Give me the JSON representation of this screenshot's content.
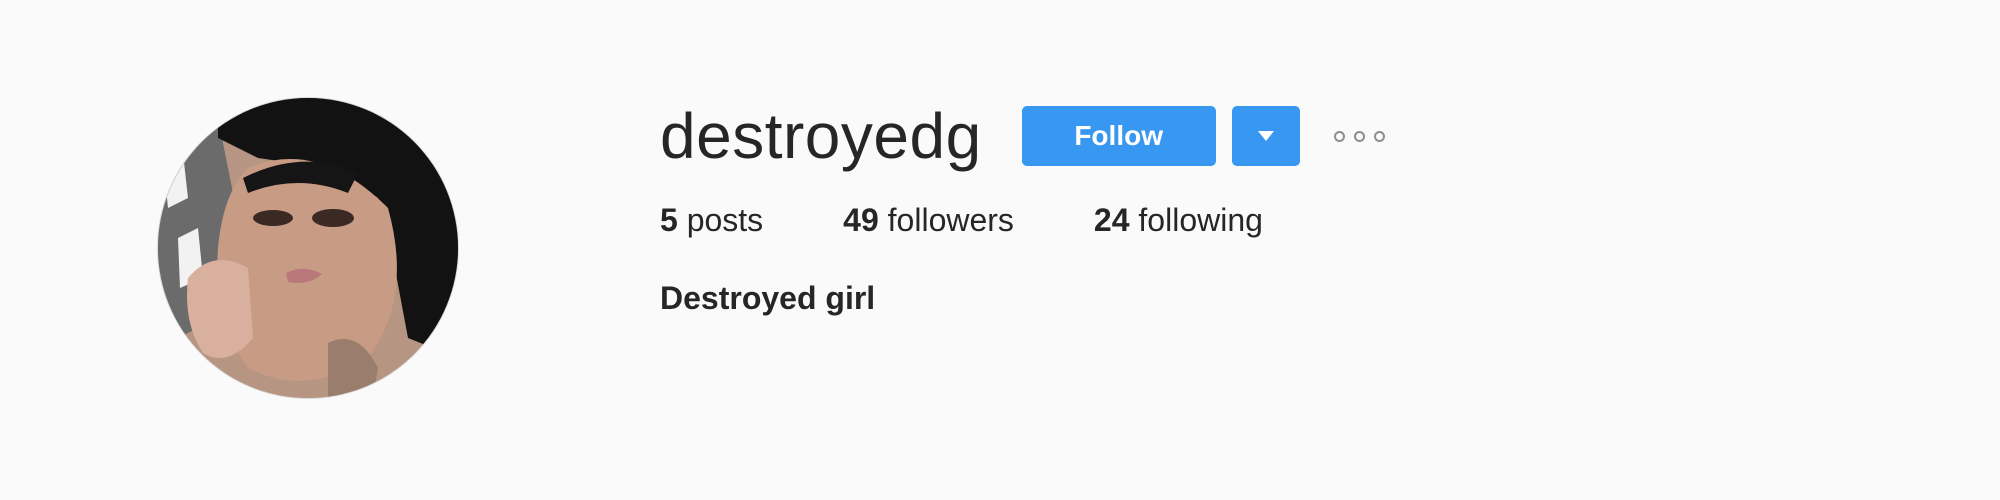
{
  "profile": {
    "username": "destroyedg",
    "full_name": "Destroyed girl",
    "avatar_alt": "destroyedg's profile picture"
  },
  "actions": {
    "follow_label": "Follow",
    "dropdown_icon": "caret-down-icon",
    "more_icon": "more-options-icon"
  },
  "stats": [
    {
      "count": "5",
      "label": "posts"
    },
    {
      "count": "49",
      "label": "followers"
    },
    {
      "count": "24",
      "label": "following"
    }
  ],
  "colors": {
    "background": "#fafafa",
    "primary_button": "#3897f0",
    "text": "#262626",
    "muted": "#8e8e8e"
  }
}
